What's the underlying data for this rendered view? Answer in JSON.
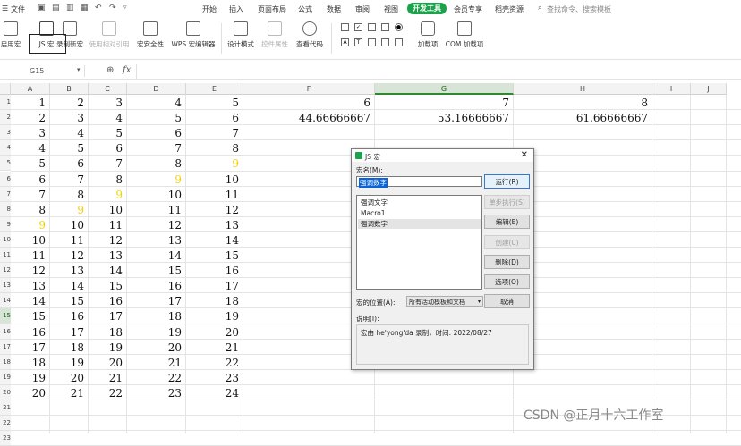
{
  "menubar": {
    "file": "文件",
    "tabs": [
      "开始",
      "插入",
      "页面布局",
      "公式",
      "数据",
      "审阅",
      "视图",
      "开发工具",
      "会员专享",
      "稻壳资源"
    ],
    "active_tab": "开发工具",
    "search": "查找命令、搜索模板"
  },
  "ribbon": {
    "items": [
      "启用宏",
      "JS 宏",
      "录制新宏",
      "使用相对引用",
      "宏安全性",
      "WPS 宏编辑器",
      "设计模式",
      "控件属性",
      "查看代码",
      "加载项",
      "COM 加载项"
    ],
    "disabled": [
      "使用相对引用",
      "控件属性"
    ]
  },
  "formula": {
    "namebox": "G15",
    "fx": "fx"
  },
  "grid": {
    "columns": [
      "A",
      "B",
      "C",
      "D",
      "E",
      "F",
      "G",
      "H",
      "I",
      "J"
    ],
    "selected_column": "G",
    "selected_row": 15,
    "rows": [
      1,
      2,
      3,
      4,
      5,
      6,
      7,
      8,
      9,
      10,
      11,
      12,
      13,
      14,
      15,
      16,
      17,
      18,
      19,
      20,
      21,
      22,
      23
    ],
    "cells_AE": [
      [
        1,
        2,
        3,
        4,
        5
      ],
      [
        2,
        3,
        4,
        5,
        6
      ],
      [
        3,
        4,
        5,
        6,
        7
      ],
      [
        4,
        5,
        6,
        7,
        8
      ],
      [
        5,
        6,
        7,
        8,
        9
      ],
      [
        6,
        7,
        8,
        9,
        10
      ],
      [
        7,
        8,
        9,
        10,
        11
      ],
      [
        8,
        9,
        10,
        11,
        12
      ],
      [
        9,
        10,
        11,
        12,
        13
      ],
      [
        10,
        11,
        12,
        13,
        14
      ],
      [
        11,
        12,
        13,
        14,
        15
      ],
      [
        12,
        13,
        14,
        15,
        16
      ],
      [
        13,
        14,
        15,
        16,
        17
      ],
      [
        14,
        15,
        16,
        17,
        18
      ],
      [
        15,
        16,
        17,
        18,
        19
      ],
      [
        16,
        17,
        18,
        19,
        20
      ],
      [
        17,
        18,
        19,
        20,
        21
      ],
      [
        18,
        19,
        20,
        21,
        22
      ],
      [
        19,
        20,
        21,
        22,
        23
      ],
      [
        20,
        21,
        22,
        23,
        24
      ]
    ],
    "yellow_value": 9,
    "cells_FH": [
      [
        "6",
        "7",
        "8"
      ],
      [
        "44.66666667",
        "53.16666667",
        "61.66666667"
      ]
    ],
    "highlight_color": "#f2d10a"
  },
  "dialog": {
    "title": "JS 宏",
    "macro_name_label": "宏名(M):",
    "macro_name_value": "强调数字",
    "macros": [
      "强调文字",
      "Macro1",
      "强调数字"
    ],
    "selected_macro": "强调数字",
    "buttons": {
      "run": "运行(R)",
      "step": "单步执行(S)",
      "edit": "编辑(E)",
      "create": "创建(C)",
      "delete": "删除(D)",
      "options": "选项(O)",
      "cancel": "取消"
    },
    "location_label": "宏的位置(A):",
    "location_value": "所有活动模板和文档",
    "desc_label": "说明(I):",
    "desc_text": "宏由 he'yong'da 录制，时间: 2022/08/27",
    "close": "✕"
  },
  "watermark": "CSDN @正月十六工作室",
  "colors": {
    "accent": "#1aa34a",
    "selected_header": "#d6e5d6",
    "selection_blue": "#0a64d8"
  }
}
